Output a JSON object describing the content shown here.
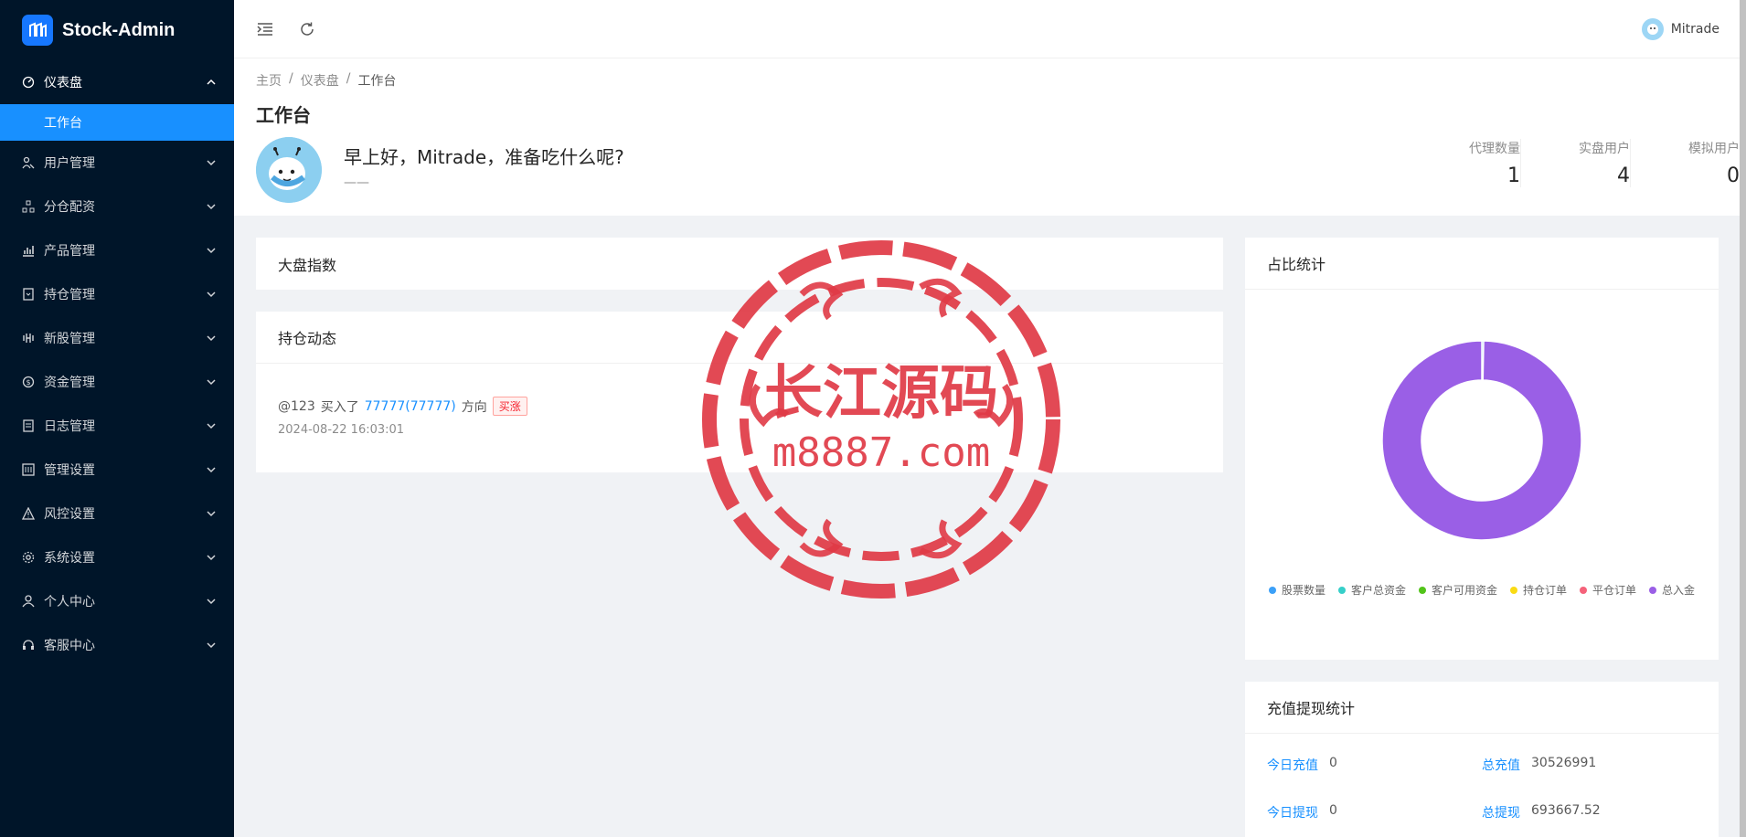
{
  "app": {
    "title": "Stock-Admin"
  },
  "sidebar": {
    "items": [
      {
        "label": "仪表盘",
        "icon": "dashboard-icon",
        "open": true,
        "children": [
          {
            "label": "工作台",
            "active": true
          }
        ]
      },
      {
        "label": "用户管理",
        "icon": "user-manage-icon"
      },
      {
        "label": "分仓配资",
        "icon": "cluster-icon"
      },
      {
        "label": "产品管理",
        "icon": "chart-icon"
      },
      {
        "label": "持仓管理",
        "icon": "position-icon"
      },
      {
        "label": "新股管理",
        "icon": "ipo-icon"
      },
      {
        "label": "资金管理",
        "icon": "money-icon"
      },
      {
        "label": "日志管理",
        "icon": "log-icon"
      },
      {
        "label": "管理设置",
        "icon": "admin-settings-icon"
      },
      {
        "label": "风控设置",
        "icon": "warning-icon"
      },
      {
        "label": "系统设置",
        "icon": "gear-icon"
      },
      {
        "label": "个人中心",
        "icon": "person-icon"
      },
      {
        "label": "客服中心",
        "icon": "headset-icon"
      }
    ]
  },
  "header": {
    "username": "Mitrade"
  },
  "breadcrumb": [
    "主页",
    "仪表盘",
    "工作台"
  ],
  "page": {
    "title": "工作台",
    "welcome": "早上好，Mitrade，准备吃什么呢?",
    "welcome_sub": "——",
    "stats": [
      {
        "label": "代理数量",
        "value": "1"
      },
      {
        "label": "实盘用户",
        "value": "4"
      },
      {
        "label": "模拟用户",
        "value": "0"
      }
    ]
  },
  "cards": {
    "index": {
      "title": "大盘指数"
    },
    "positions": {
      "title": "持仓动态",
      "feed": [
        {
          "user": "@123",
          "action": "买入了",
          "stock": "77777(77777)",
          "direction_label": "方向",
          "tag": "买涨",
          "time": "2024-08-22 16:03:01"
        }
      ]
    },
    "ratio": {
      "title": "占比统计"
    },
    "recharge": {
      "title": "充值提现统计",
      "items": [
        {
          "label": "今日充值",
          "value": "0"
        },
        {
          "label": "总充值",
          "value": "30526991"
        },
        {
          "label": "今日提现",
          "value": "0"
        },
        {
          "label": "总提现",
          "value": "693667.52"
        }
      ]
    }
  },
  "chart_data": {
    "type": "pie",
    "title": "",
    "series": [
      {
        "name": "股票数量",
        "color": "#3ba0f8",
        "value": 0.3
      },
      {
        "name": "客户总资金",
        "color": "#36cfc9",
        "value": 0
      },
      {
        "name": "客户可用资金",
        "color": "#52c41a",
        "value": 0
      },
      {
        "name": "持仓订单",
        "color": "#fadb14",
        "value": 0
      },
      {
        "name": "平仓订单",
        "color": "#f5627a",
        "value": 0
      },
      {
        "name": "总入金",
        "color": "#9a5fe6",
        "value": 99.7
      }
    ],
    "legend_position": "bottom"
  },
  "watermark": {
    "line1": "长江源码",
    "line2": "m8887.com",
    "color": "#e03a46"
  }
}
